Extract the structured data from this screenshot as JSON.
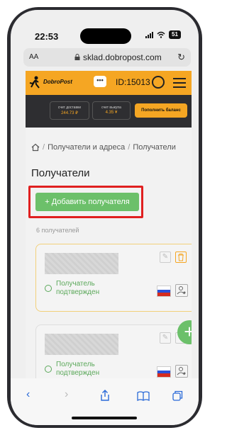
{
  "status_bar": {
    "time": "22:53",
    "battery": "51"
  },
  "browser": {
    "text_size_label": "AA",
    "url": "sklad.dobropost.com"
  },
  "header": {
    "logo_text": "DobroPost",
    "chat_label": "•••",
    "user_id": "ID:15013"
  },
  "account": {
    "delivery_label": "счет доставки",
    "delivery_value": "244.73 ₽",
    "buyout_label": "счет выкупа",
    "buyout_value": "4.35 ¥",
    "topup_label": "Пополнить баланс"
  },
  "breadcrumb": {
    "item1": "Получатели и адреса",
    "item2": "Получатели"
  },
  "page": {
    "title": "Получатели",
    "add_button": "+ Добавить получателя",
    "count": "6 получателей"
  },
  "recipients": [
    {
      "status": "Получатель подтвержден"
    },
    {
      "status": "Получатель подтвержден"
    }
  ],
  "fab_label": "+",
  "colors": {
    "brand": "#f5a623",
    "accent_green": "#6cc06a",
    "highlight_red": "#e02020",
    "dark_panel": "#2e2e31"
  }
}
